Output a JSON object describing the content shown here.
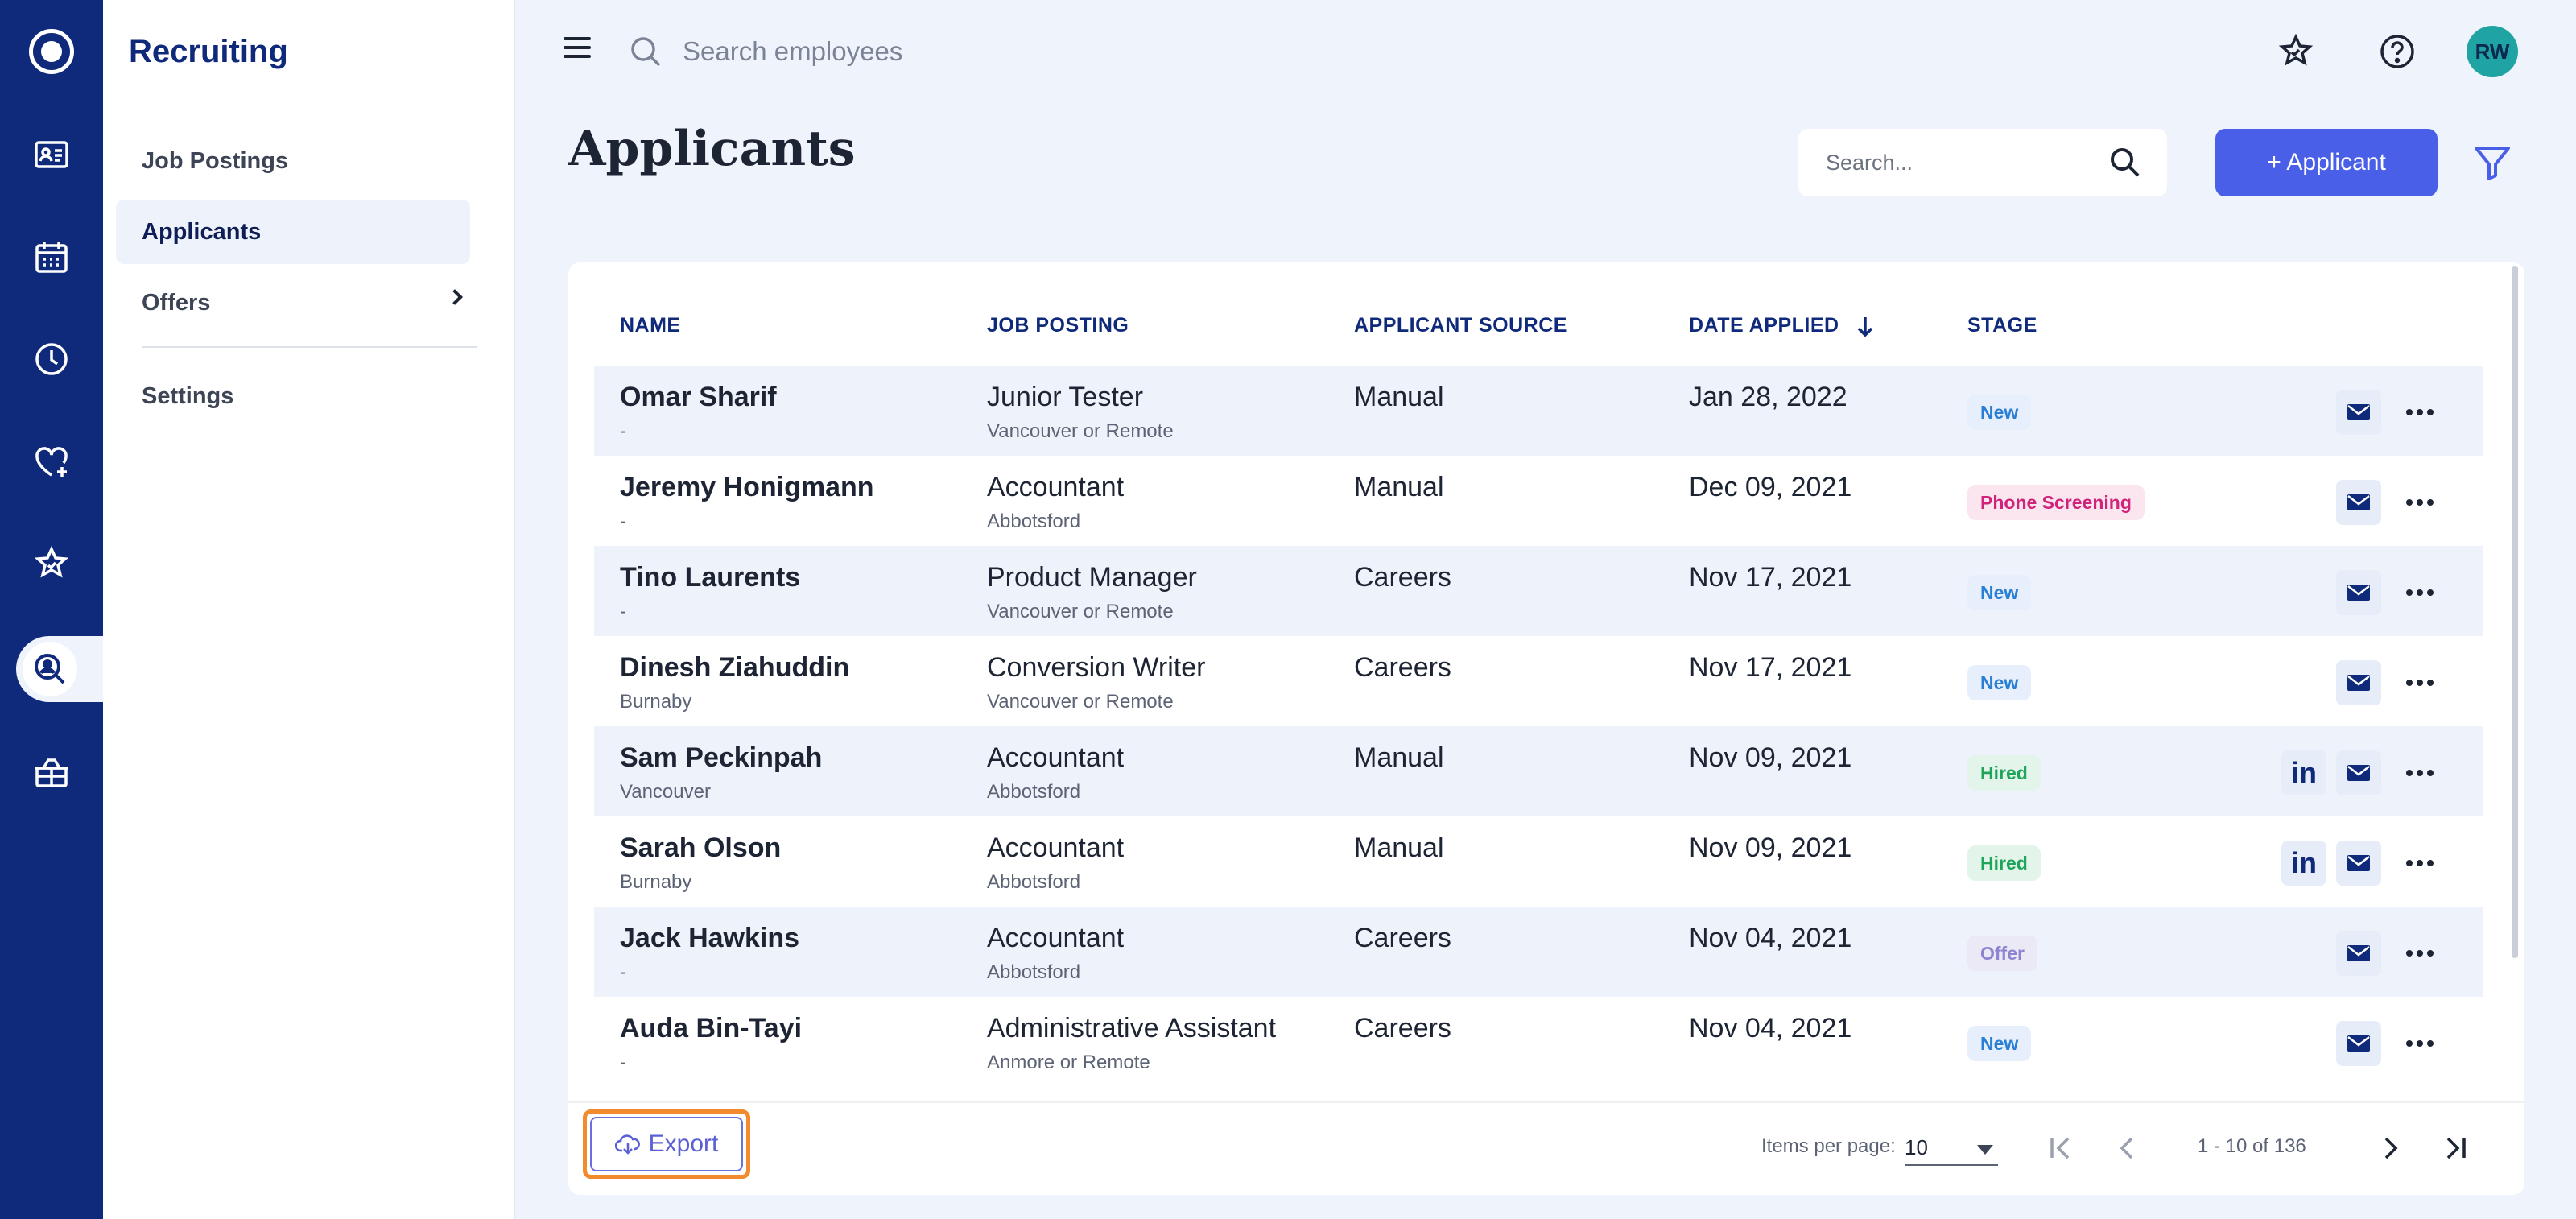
{
  "app": {
    "section_title": "Recruiting"
  },
  "subnav": {
    "items": [
      {
        "label": "Job Postings"
      },
      {
        "label": "Applicants"
      },
      {
        "label": "Offers"
      },
      {
        "label": "Settings"
      }
    ]
  },
  "topbar": {
    "search_placeholder": "Search employees",
    "avatar_initials": "RW"
  },
  "header": {
    "title": "Applicants",
    "search_placeholder": "Search...",
    "add_button": "+ Applicant"
  },
  "table": {
    "columns": [
      "NAME",
      "JOB POSTING",
      "APPLICANT SOURCE",
      "DATE APPLIED",
      "STAGE"
    ],
    "rows": [
      {
        "name": "Omar Sharif",
        "location": "-",
        "job": "Junior Tester",
        "job_location": "Vancouver or Remote",
        "source": "Manual",
        "date": "Jan 28, 2022",
        "stage": "New"
      },
      {
        "name": "Jeremy Honigmann",
        "location": "-",
        "job": "Accountant",
        "job_location": "Abbotsford",
        "source": "Manual",
        "date": "Dec 09, 2021",
        "stage": "Phone Screening"
      },
      {
        "name": "Tino Laurents",
        "location": "-",
        "job": "Product Manager",
        "job_location": "Vancouver or Remote",
        "source": "Careers",
        "date": "Nov 17, 2021",
        "stage": "New"
      },
      {
        "name": "Dinesh Ziahuddin",
        "location": "Burnaby",
        "job": "Conversion Writer",
        "job_location": "Vancouver or Remote",
        "source": "Careers",
        "date": "Nov 17, 2021",
        "stage": "New"
      },
      {
        "name": "Sam Peckinpah",
        "location": "Vancouver",
        "job": "Accountant",
        "job_location": "Abbotsford",
        "source": "Manual",
        "date": "Nov 09, 2021",
        "stage": "Hired"
      },
      {
        "name": "Sarah Olson",
        "location": "Burnaby",
        "job": "Accountant",
        "job_location": "Abbotsford",
        "source": "Manual",
        "date": "Nov 09, 2021",
        "stage": "Hired"
      },
      {
        "name": "Jack Hawkins",
        "location": "-",
        "job": "Accountant",
        "job_location": "Abbotsford",
        "source": "Careers",
        "date": "Nov 04, 2021",
        "stage": "Offer"
      },
      {
        "name": "Auda Bin-Tayi",
        "location": "-",
        "job": "Administrative Assistant",
        "job_location": "Anmore or Remote",
        "source": "Careers",
        "date": "Nov 04, 2021",
        "stage": "New"
      }
    ]
  },
  "footer": {
    "export_label": "Export",
    "items_per_page_label": "Items per page:",
    "items_per_page_value": "10",
    "range": "1 - 10 of 136"
  },
  "colors": {
    "rail": "#0f2a7a",
    "accent": "#4a5fe8",
    "title": "#0f2a7a",
    "export_highlight": "#f28a2e"
  }
}
